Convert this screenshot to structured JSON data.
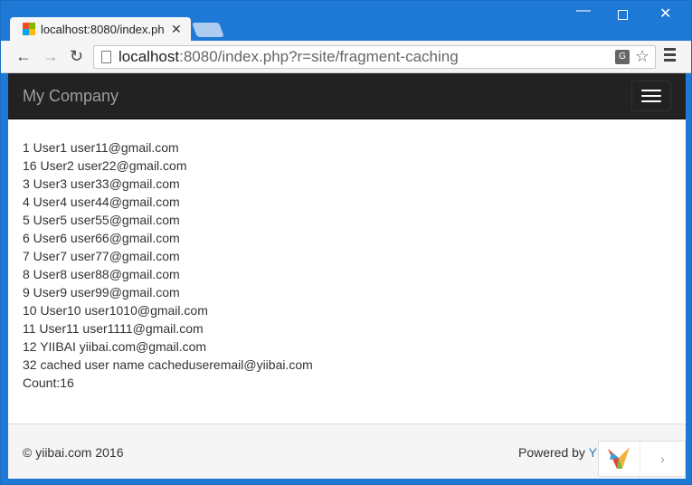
{
  "browser": {
    "tab_title": "localhost:8080/index.ph",
    "url_host": "localhost",
    "url_rest": ":8080/index.php?r=site/fragment-caching"
  },
  "navbar": {
    "brand": "My Company"
  },
  "content": {
    "lines": [
      "1 User1 user11@gmail.com",
      "16 User2 user22@gmail.com",
      "3 User3 user33@gmail.com",
      "4 User4 user44@gmail.com",
      "5 User5 user55@gmail.com",
      "6 User6 user66@gmail.com",
      "7 User7 user77@gmail.com",
      "8 User8 user88@gmail.com",
      "9 User9 user99@gmail.com",
      "10 User10 user1010@gmail.com",
      "11 User11 user1111@gmail.com",
      "12 YIIBAI yiibai.com@gmail.com",
      "32 cached user name cacheduseremail@yiibai.com",
      "Count:16"
    ]
  },
  "footer": {
    "copyright": "© yiibai.com 2016",
    "powered_by": "Powered by ",
    "powered_link": "Y"
  },
  "colors": {
    "navbar_bg": "#222222",
    "brand": "#9d9d9d",
    "link": "#337ab7",
    "window_frame": "#1e78d6"
  }
}
